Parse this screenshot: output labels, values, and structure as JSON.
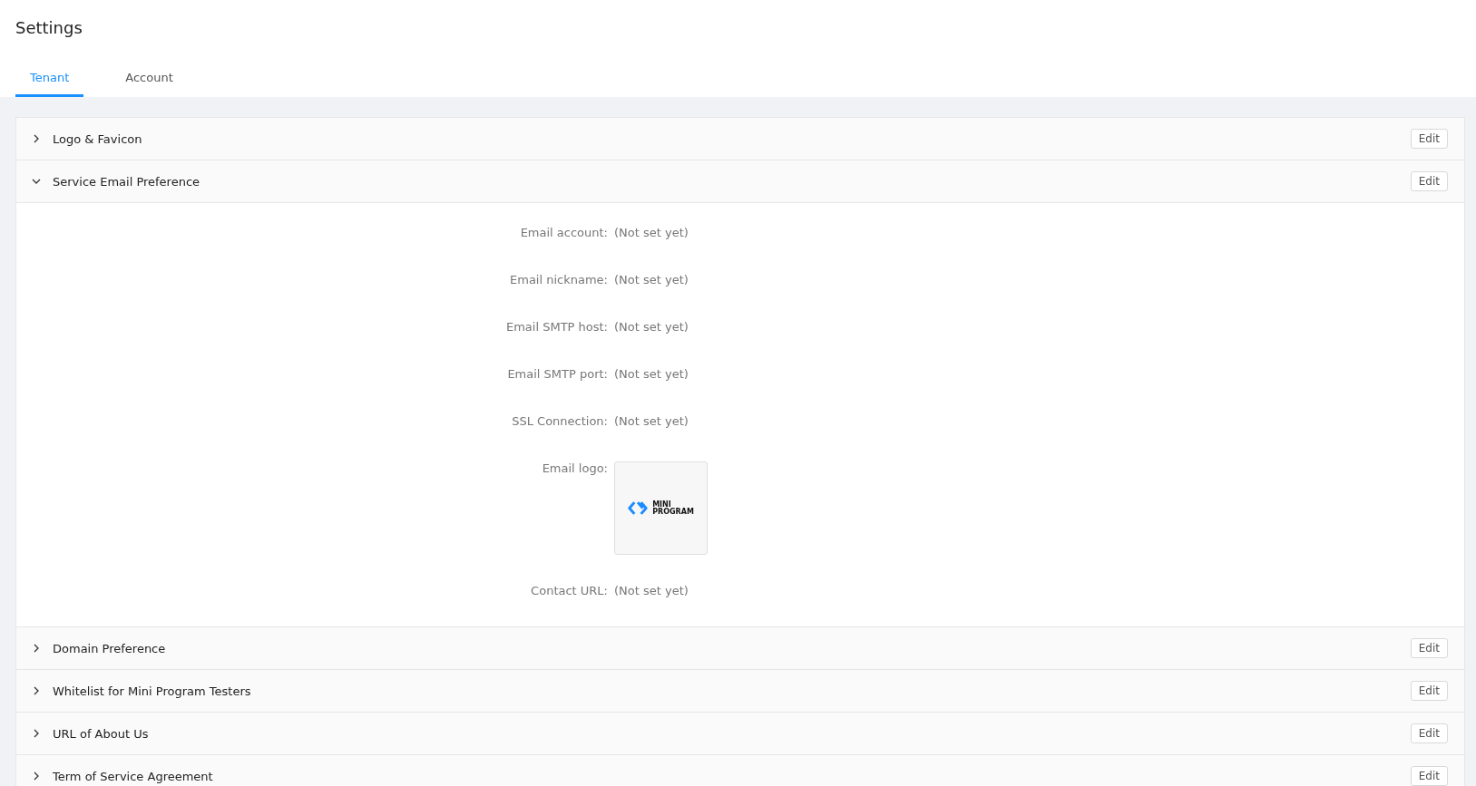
{
  "page_title": "Settings",
  "tabs": [
    {
      "label": "Tenant",
      "selected": true
    },
    {
      "label": "Account",
      "selected": false
    }
  ],
  "sections": [
    {
      "title": "Logo & Favicon",
      "expanded": false,
      "action": "Edit"
    },
    {
      "title": "Service Email Preference",
      "expanded": true,
      "action": "Edit",
      "fields": [
        {
          "kind": "text",
          "label": "Email account:",
          "value": "(Not set yet)"
        },
        {
          "kind": "text",
          "label": "Email nickname:",
          "value": "(Not set yet)"
        },
        {
          "kind": "text",
          "label": "Email SMTP host:",
          "value": "(Not set yet)"
        },
        {
          "kind": "text",
          "label": "Email SMTP port:",
          "value": "(Not set yet)"
        },
        {
          "kind": "text",
          "label": "SSL Connection:",
          "value": "(Not set yet)"
        },
        {
          "kind": "image",
          "label": "Email logo:",
          "logo_text": [
            "MINI",
            "PROGRAM"
          ]
        },
        {
          "kind": "text",
          "label": "Contact URL:",
          "value": "(Not set yet)"
        }
      ]
    },
    {
      "title": "Domain Preference",
      "expanded": false,
      "action": "Edit"
    },
    {
      "title": "Whitelist for Mini Program Testers",
      "expanded": false,
      "action": "Edit"
    },
    {
      "title": "URL of About Us",
      "expanded": false,
      "action": "Edit"
    },
    {
      "title": "Term of Service Agreement",
      "expanded": false,
      "action": "Edit"
    }
  ]
}
